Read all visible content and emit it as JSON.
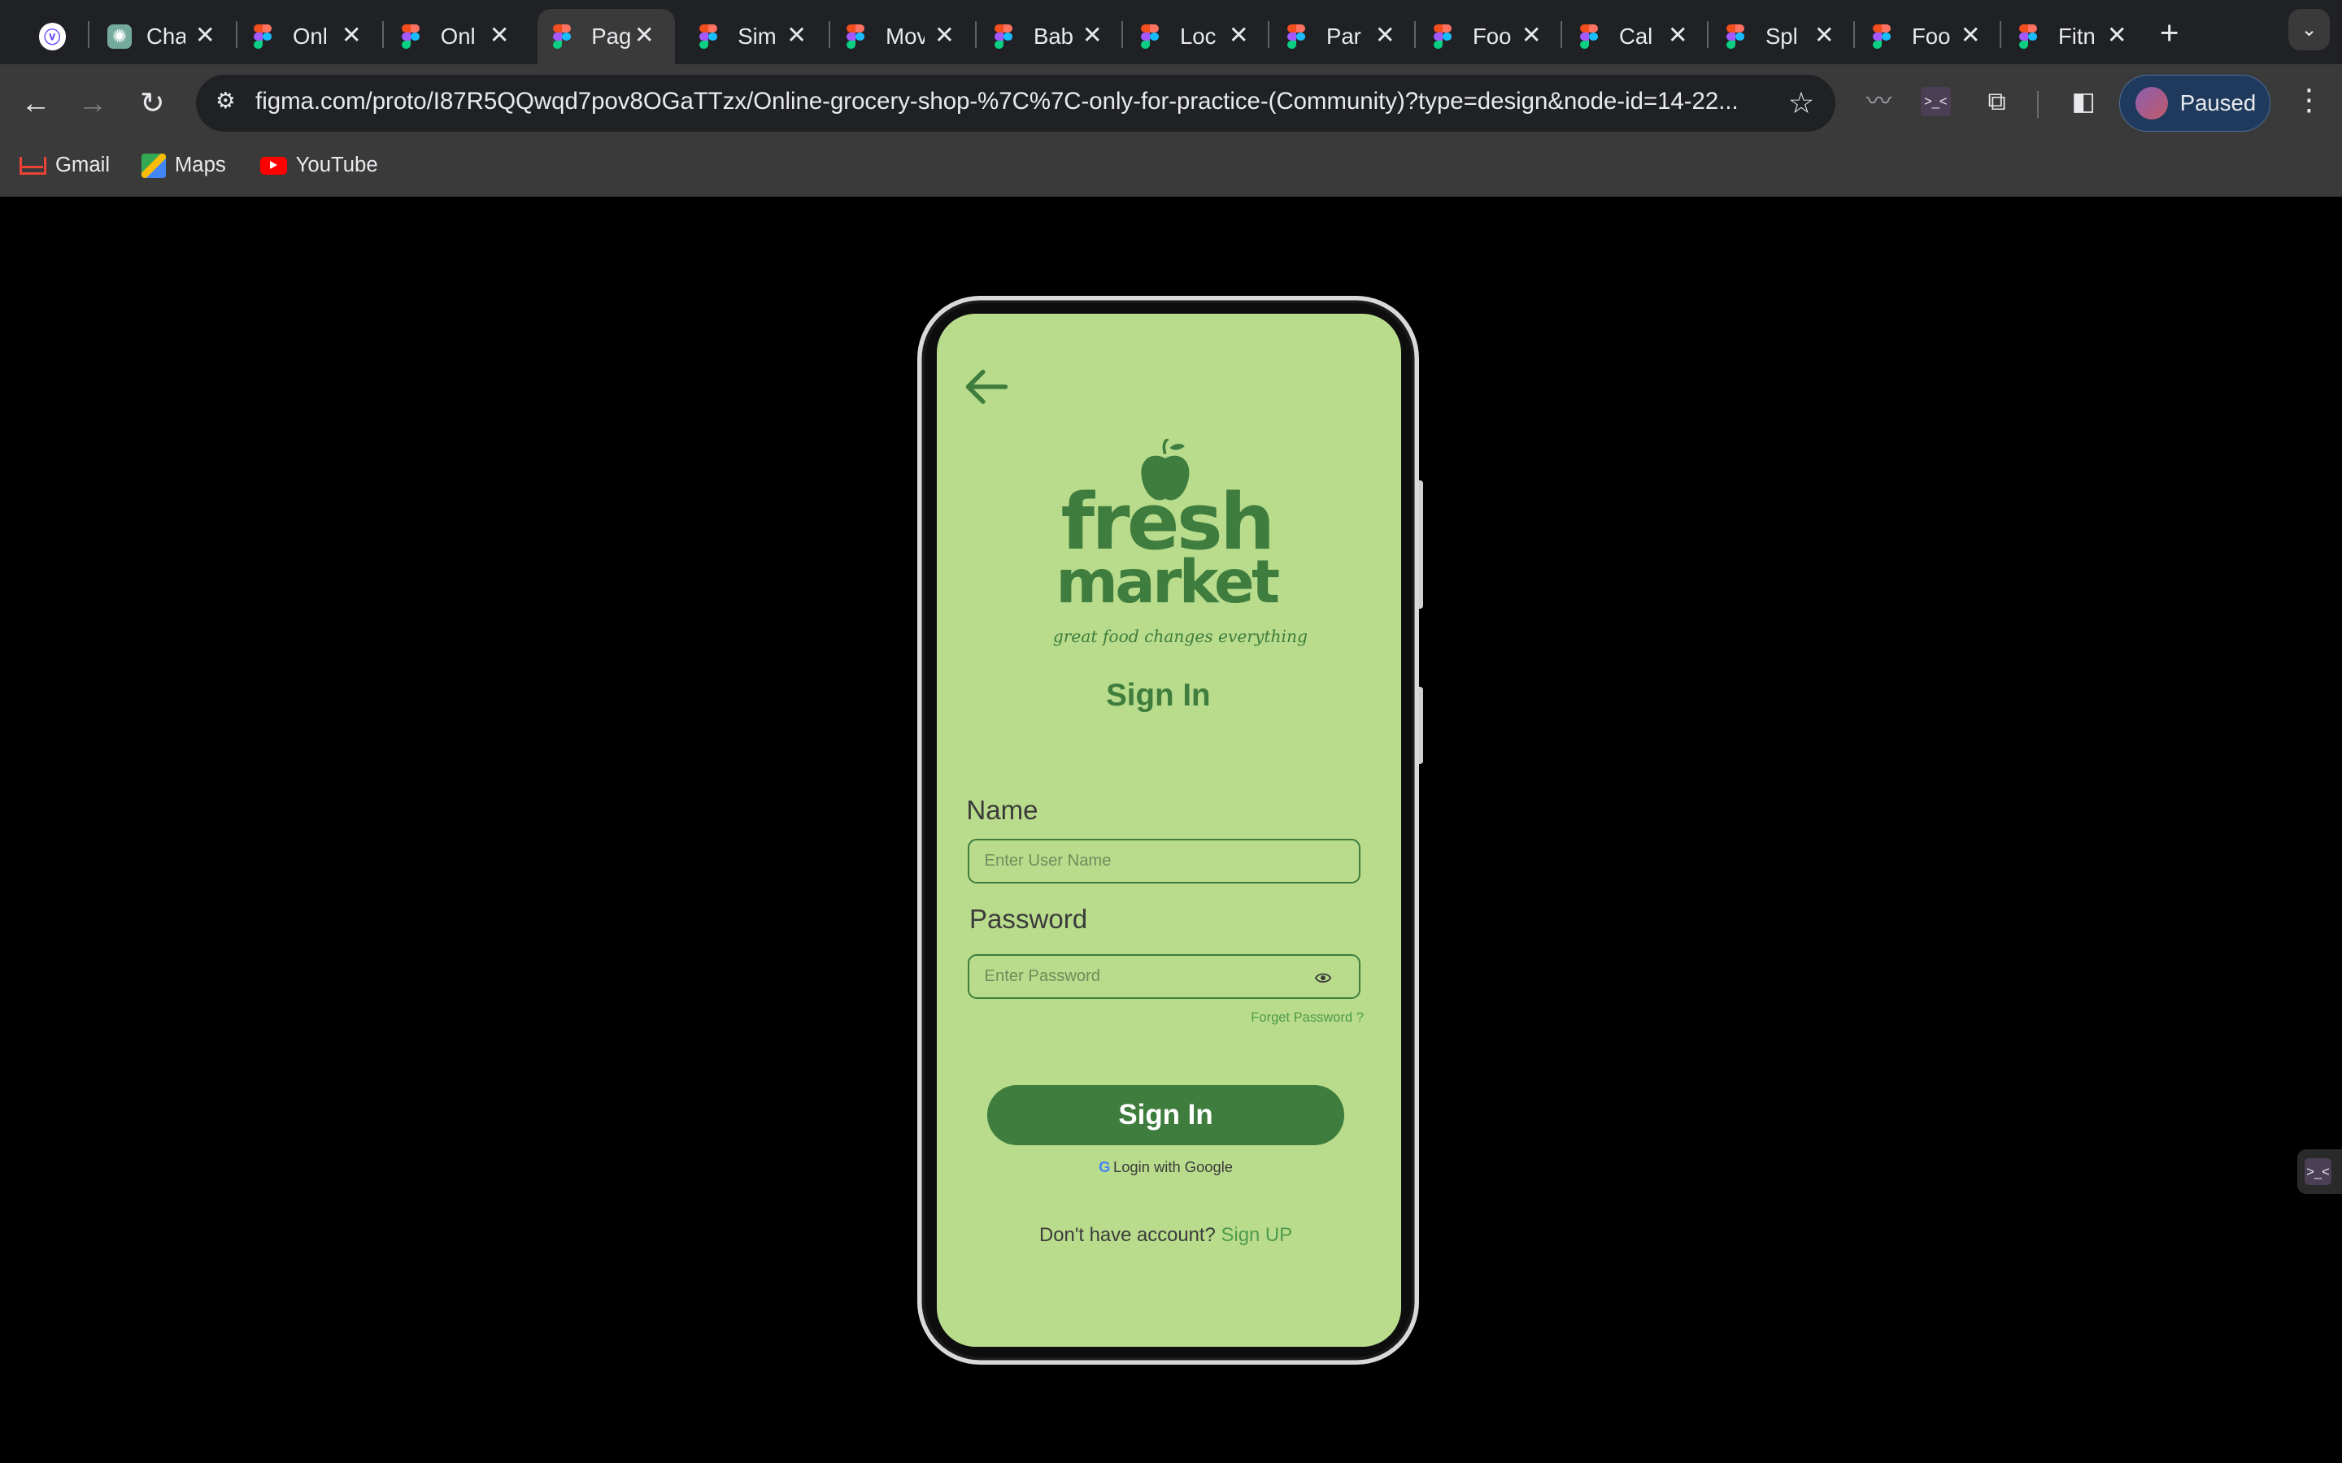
{
  "browser": {
    "tabs": [
      {
        "label": ""
      },
      {
        "label": "Cha"
      },
      {
        "label": "Onl"
      },
      {
        "label": "Onl"
      },
      {
        "label": "Pag"
      },
      {
        "label": "Sim"
      },
      {
        "label": "Mov"
      },
      {
        "label": "Bab"
      },
      {
        "label": "Loc"
      },
      {
        "label": "Par"
      },
      {
        "label": "Foo"
      },
      {
        "label": "Cal"
      },
      {
        "label": "Spl"
      },
      {
        "label": "Foo"
      },
      {
        "label": "Fitn"
      }
    ],
    "active_tab_index": 4,
    "url": "figma.com/proto/I87R5QQwqd7pov8OGaTTzx/Online-grocery-shop-%7C%7C-only-for-practice-(Community)?type=design&node-id=14-22...",
    "profile_label": "Paused",
    "bookmarks": [
      {
        "label": "Gmail"
      },
      {
        "label": "Maps"
      },
      {
        "label": "YouTube"
      }
    ]
  },
  "app": {
    "logo": {
      "line1": "fresh",
      "line2": "market",
      "tagline": "great food changes everything"
    },
    "title": "Sign In",
    "name_label": "Name",
    "name_placeholder": "Enter User Name",
    "password_label": "Password",
    "password_placeholder": "Enter Password",
    "forgot_label": "Forget Password ?",
    "signin_button": "Sign In",
    "google_label": "Login with Google",
    "no_account_text": "Don't have account?",
    "signup_link": "Sign UP"
  },
  "colors": {
    "screen_bg": "#b9dc8c",
    "brand_green": "#3e7d3d",
    "link_green": "#4f9a4c"
  }
}
